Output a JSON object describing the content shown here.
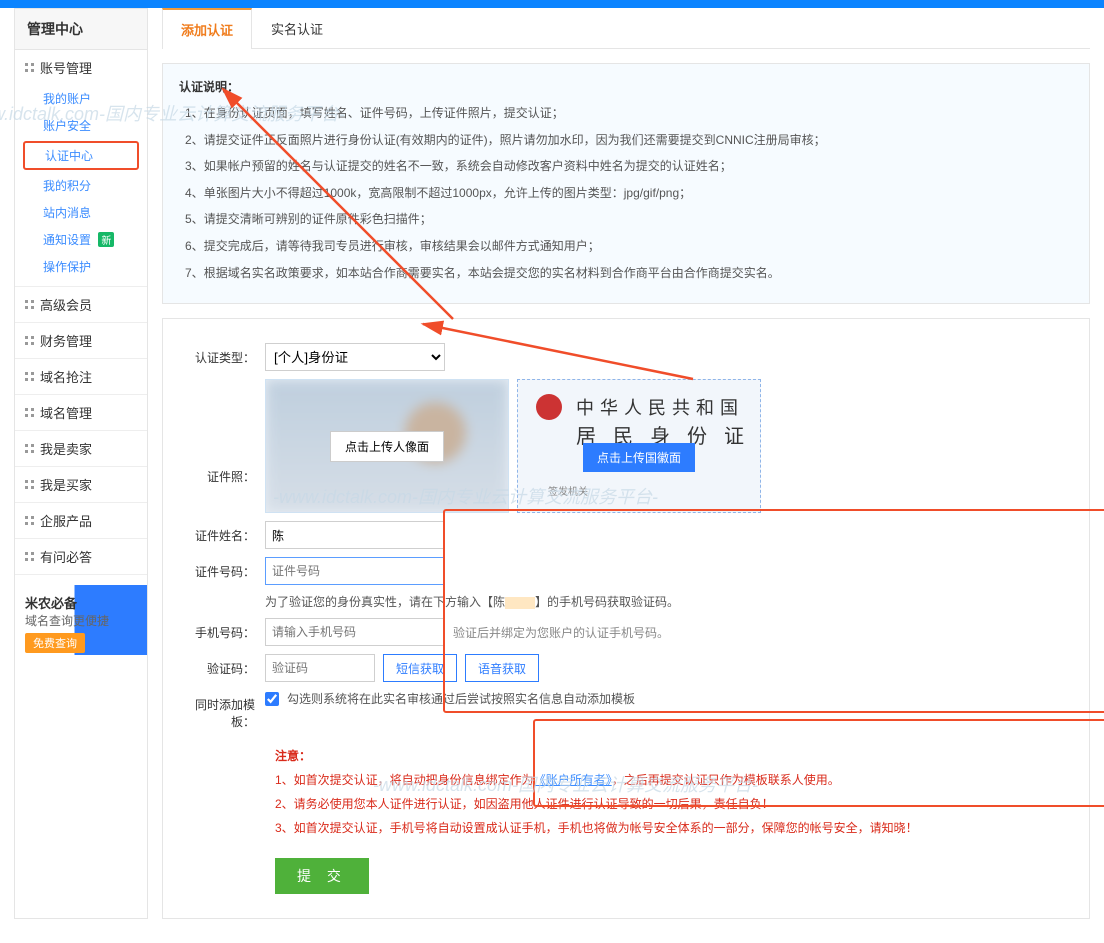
{
  "sidebar": {
    "title": "管理中心",
    "groups": [
      {
        "name": "账号管理",
        "expanded": true,
        "items": [
          {
            "label": "我的账户",
            "key": "my-account"
          },
          {
            "label": "账户安全",
            "key": "account-security"
          },
          {
            "label": "认证中心",
            "key": "verify-center",
            "active": true
          },
          {
            "label": "我的积分",
            "key": "my-points"
          },
          {
            "label": "站内消息",
            "key": "messages"
          },
          {
            "label": "通知设置",
            "key": "notify",
            "badge": "新"
          },
          {
            "label": "操作保护",
            "key": "op-protect"
          }
        ]
      },
      {
        "name": "高级会员",
        "expanded": false
      },
      {
        "name": "财务管理",
        "expanded": false
      },
      {
        "name": "域名抢注",
        "expanded": false
      },
      {
        "name": "域名管理",
        "expanded": false
      },
      {
        "name": "我是卖家",
        "expanded": false
      },
      {
        "name": "我是买家",
        "expanded": false
      },
      {
        "name": "企服产品",
        "expanded": false
      },
      {
        "name": "有问必答",
        "expanded": false
      }
    ],
    "promo": {
      "line1": "米农必备",
      "line2": "域名查询更便捷",
      "button": "免费查询"
    }
  },
  "tabs": [
    {
      "label": "添加认证",
      "active": true
    },
    {
      "label": "实名认证",
      "active": false
    }
  ],
  "instructions": {
    "title": "认证说明：",
    "items": [
      "在身份认证页面，填写姓名、证件号码，上传证件照片，提交认证；",
      "请提交证件正反面照片进行身份认证(有效期内的证件)，照片请勿加水印，因为我们还需要提交到CNNIC注册局审核；",
      "如果帐户预留的姓名与认证提交的姓名不一致，系统会自动修改客户资料中姓名为提交的认证姓名；",
      "单张图片大小不得超过1000k，宽高限制不超过1000px，允许上传的图片类型：jpg/gif/png；",
      "请提交清晰可辨别的证件原件彩色扫描件；",
      "提交完成后，请等待我司专员进行审核，审核结果会以邮件方式通知用户；",
      "根据域名实名政策要求，如本站合作商需要实名，本站会提交您的实名材料到合作商平台由合作商提交实名。"
    ]
  },
  "form": {
    "type_label": "认证类型：",
    "type_value": "[个人]身份证",
    "photo_label": "证件照：",
    "upload_front": "点击上传人像面",
    "upload_back": "点击上传国徽面",
    "id_country": "中华人民共和国",
    "id_title": "居 民 身 份 证",
    "id_issuer": "签发机关",
    "name_label": "证件姓名：",
    "name_value": "陈",
    "num_label": "证件号码：",
    "num_placeholder": "证件号码",
    "verify_tip_pre": "为了验证您的身份真实性，请在下方输入【陈",
    "verify_tip_post": "】的手机号码获取验证码。",
    "phone_label": "手机号码：",
    "phone_placeholder": "请输入手机号码",
    "phone_hint": "验证后并绑定为您账户的认证手机号码。",
    "code_label": "验证码：",
    "code_placeholder": "验证码",
    "sms_btn": "短信获取",
    "voice_btn": "语音获取",
    "template_label": "同时添加模板：",
    "template_hint": "勾选则系统将在此实名审核通过后尝试按照实名信息自动添加模板"
  },
  "notice": {
    "title": "注意：",
    "items": [
      {
        "pre": "1、如首次提交认证，将自动把身份信息绑定作为",
        "link": "《账户所有者》",
        "post": "，之后再提交认证只作为模板联系人使用。"
      },
      {
        "text": "2、请务必使用您本人证件进行认证，如因盗用他人证件进行认证导致的一切后果，责任自负！"
      },
      {
        "text": "3、如首次提交认证，手机号将自动设置成认证手机，手机也将做为帐号安全体系的一部分，保障您的帐号安全，请知晓！"
      }
    ]
  },
  "submit": "提 交",
  "watermark": "-www.idctalk.com-国内专业云计算交流服务平台-"
}
